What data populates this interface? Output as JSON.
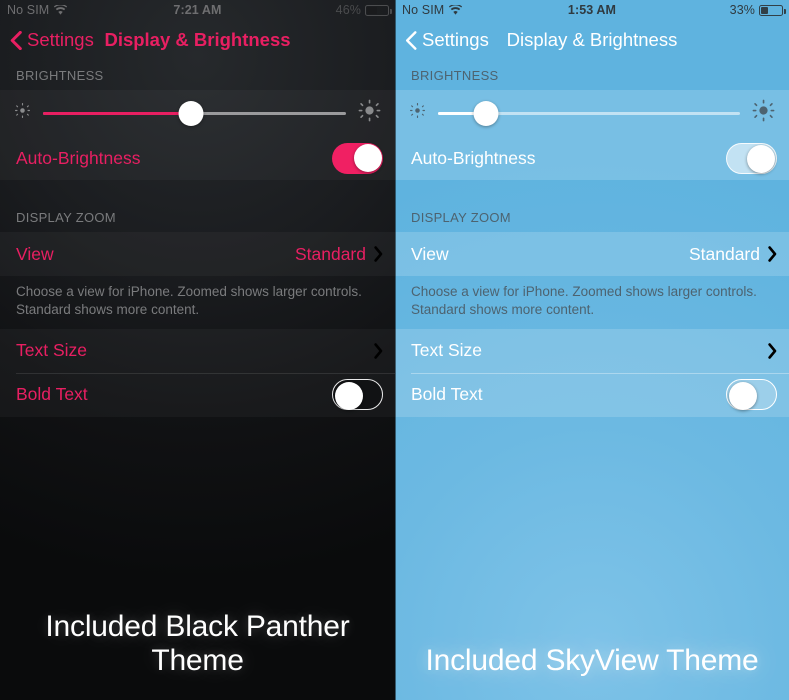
{
  "panels": [
    {
      "theme_name": "dark",
      "caption": "Included Black Panther Theme",
      "accent": "#e81f62",
      "statusbar": {
        "carrier": "No SIM",
        "wifi_icon": "wifi-icon",
        "time": "7:21 AM",
        "battery_percent": "46%",
        "battery_level": 46,
        "battery_icon": "battery-icon"
      },
      "navbar": {
        "back_label": "Settings",
        "back_icon": "chevron-left-icon",
        "title": "Display & Brightness"
      },
      "brightness": {
        "header": "BRIGHTNESS",
        "slider_low_icon": "brightness-low-icon",
        "slider_high_icon": "brightness-high-icon",
        "slider_value": 49,
        "auto_label": "Auto-Brightness",
        "auto_on": true
      },
      "display_zoom": {
        "header": "DISPLAY ZOOM",
        "view_label": "View",
        "view_value": "Standard",
        "view_chevron_icon": "chevron-right-icon",
        "footnote": "Choose a view for iPhone. Zoomed shows larger controls. Standard shows more content."
      },
      "text": {
        "text_size_label": "Text Size",
        "text_size_chevron_icon": "chevron-right-icon",
        "bold_text_label": "Bold Text",
        "bold_text_on": false
      }
    },
    {
      "theme_name": "light",
      "caption": "Included SkyView Theme",
      "accent": "#ffffff",
      "statusbar": {
        "carrier": "No SIM",
        "wifi_icon": "wifi-icon",
        "time": "1:53 AM",
        "battery_percent": "33%",
        "battery_level": 33,
        "battery_icon": "battery-icon"
      },
      "navbar": {
        "back_label": "Settings",
        "back_icon": "chevron-left-icon",
        "title": "Display & Brightness"
      },
      "brightness": {
        "header": "BRIGHTNESS",
        "slider_low_icon": "brightness-low-icon",
        "slider_high_icon": "brightness-high-icon",
        "slider_value": 16,
        "auto_label": "Auto-Brightness",
        "auto_on": true
      },
      "display_zoom": {
        "header": "DISPLAY ZOOM",
        "view_label": "View",
        "view_value": "Standard",
        "view_chevron_icon": "chevron-right-icon",
        "footnote": "Choose a view for iPhone. Zoomed shows larger controls. Standard shows more content."
      },
      "text": {
        "text_size_label": "Text Size",
        "text_size_chevron_icon": "chevron-right-icon",
        "bold_text_label": "Bold Text",
        "bold_text_on": false
      }
    }
  ]
}
